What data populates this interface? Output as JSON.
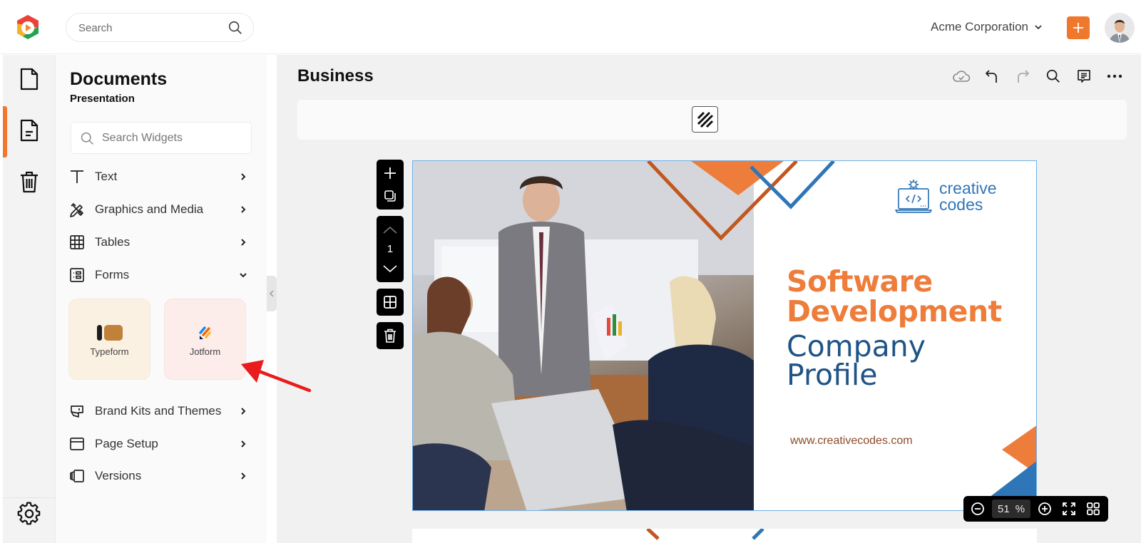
{
  "topbar": {
    "search_placeholder": "Search",
    "organization": "Acme Corporation",
    "add_label": "+",
    "icons": {
      "logo": "app-logo",
      "search": "search-icon",
      "org_chevron": "chevron-down-icon",
      "add": "plus-icon",
      "avatar": "user-avatar"
    }
  },
  "rail": {
    "items": [
      {
        "name": "documents",
        "icon": "file-icon",
        "active": false
      },
      {
        "name": "presentation",
        "icon": "file-text-icon",
        "active": true
      },
      {
        "name": "trash",
        "icon": "trash-icon",
        "active": false
      }
    ],
    "settings_icon": "gear-icon"
  },
  "panel": {
    "title": "Documents",
    "subtitle": "Presentation",
    "search_placeholder": "Search Widgets",
    "items": [
      {
        "label": "Text",
        "icon": "text-icon",
        "state": "collapsed"
      },
      {
        "label": "Graphics and Media",
        "icon": "graphics-icon",
        "state": "collapsed"
      },
      {
        "label": "Tables",
        "icon": "table-icon",
        "state": "collapsed"
      },
      {
        "label": "Forms",
        "icon": "form-icon",
        "state": "expanded"
      },
      {
        "label": "Brand Kits and Themes",
        "icon": "brand-kit-icon",
        "state": "collapsed"
      },
      {
        "label": "Page Setup",
        "icon": "page-setup-icon",
        "state": "collapsed"
      },
      {
        "label": "Versions",
        "icon": "versions-icon",
        "state": "collapsed"
      }
    ],
    "form_widgets": [
      {
        "label": "Typeform",
        "icon": "typeform-logo",
        "bg": "#fbf1e3"
      },
      {
        "label": "Jotform",
        "icon": "jotform-logo",
        "bg": "#fcecea"
      }
    ]
  },
  "editor": {
    "title": "Business",
    "toolbar": [
      {
        "name": "cloud-saved",
        "icon": "cloud-check-icon"
      },
      {
        "name": "undo",
        "icon": "undo-icon"
      },
      {
        "name": "redo",
        "icon": "redo-icon"
      },
      {
        "name": "search",
        "icon": "search-icon"
      },
      {
        "name": "comments",
        "icon": "comment-icon"
      },
      {
        "name": "more",
        "icon": "more-icon"
      }
    ],
    "ribbon_icon": "pattern-icon",
    "page_tools": {
      "page_number": "1"
    },
    "zoom": {
      "value": "51",
      "unit": "%"
    }
  },
  "slide": {
    "brand_line1": "creative",
    "brand_line2": "codes",
    "headline_line1": "Software",
    "headline_line2": "Development",
    "subhead_line1": "Company",
    "subhead_line2": "Profile",
    "website": "www.creativecodes.com",
    "colors": {
      "orange": "#ee7d3b",
      "blue": "#2f76b8",
      "navy": "#1f5486",
      "brown": "#c2571f"
    }
  },
  "annotation": {
    "arrow_color": "#e81c1c",
    "points_to": "Jotform"
  },
  "colors": {
    "accent": "#f0782d"
  }
}
